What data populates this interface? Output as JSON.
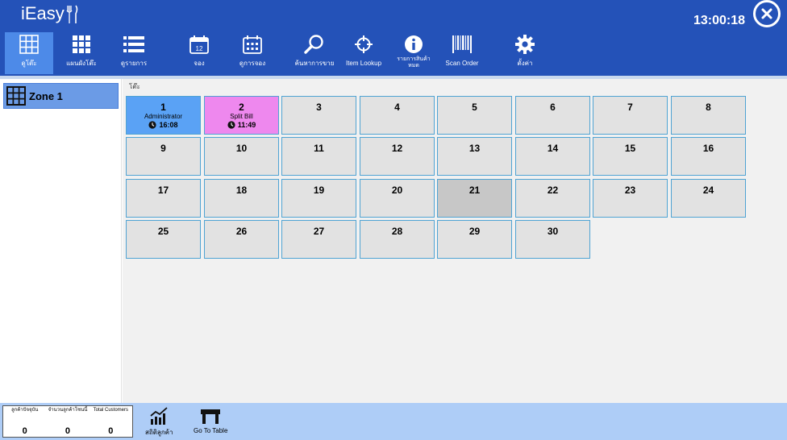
{
  "app": {
    "logo_text": "iEasy",
    "clock": "13:00:18"
  },
  "toolbar": [
    {
      "label": "ดูโต๊ะ",
      "icon": "grid-icon"
    },
    {
      "label": "แผนผังโต๊ะ",
      "icon": "grid-icon"
    },
    {
      "label": "ดูรายการ",
      "icon": "list-icon"
    },
    {
      "label": "จอง",
      "icon": "calendar-icon"
    },
    {
      "label": "ดูการจอง",
      "icon": "calendar-grid-icon"
    },
    {
      "label": "ค้นหาการขาย",
      "icon": "search-icon"
    },
    {
      "label": "Item Lookup",
      "icon": "crosshair-icon"
    },
    {
      "label": "รายการสินค้าหมด",
      "icon": "info-icon"
    },
    {
      "label": "Scan Order",
      "icon": "barcode-icon"
    },
    {
      "label": "ตั้งค่า",
      "icon": "gear-icon"
    }
  ],
  "sidebar": {
    "zone_label": "Zone 1"
  },
  "content": {
    "breadcrumb": "โต๊ะ"
  },
  "tables": [
    {
      "number": "1",
      "status": "Administrator",
      "time": "16:08",
      "state": "admin"
    },
    {
      "number": "2",
      "status": "Split Bill",
      "time": "11:49",
      "state": "split"
    },
    {
      "number": "3"
    },
    {
      "number": "4"
    },
    {
      "number": "5"
    },
    {
      "number": "6"
    },
    {
      "number": "7"
    },
    {
      "number": "8"
    },
    {
      "number": "9"
    },
    {
      "number": "10"
    },
    {
      "number": "11"
    },
    {
      "number": "12"
    },
    {
      "number": "13"
    },
    {
      "number": "14"
    },
    {
      "number": "15"
    },
    {
      "number": "16"
    },
    {
      "number": "17"
    },
    {
      "number": "18"
    },
    {
      "number": "19"
    },
    {
      "number": "20"
    },
    {
      "number": "21",
      "state": "dark"
    },
    {
      "number": "22"
    },
    {
      "number": "23"
    },
    {
      "number": "24"
    },
    {
      "number": "25"
    },
    {
      "number": "26"
    },
    {
      "number": "27"
    },
    {
      "number": "28"
    },
    {
      "number": "29"
    },
    {
      "number": "30"
    }
  ],
  "footer": {
    "stats": [
      {
        "label": "ลูกค้าปัจจุบัน",
        "value": "0"
      },
      {
        "label": "จำนวนลูกค้าโซนนี้",
        "value": "0"
      },
      {
        "label": "Total Customers",
        "value": "0"
      }
    ],
    "stats_button": "สถิติลูกค้า",
    "goto_button": "Go To Table"
  },
  "colors": {
    "header": "#2452b8",
    "active_tool": "#4d8ae8",
    "admin_table": "#5aa2f5",
    "split_table": "#ee88ee",
    "footer": "#aecdf7"
  }
}
